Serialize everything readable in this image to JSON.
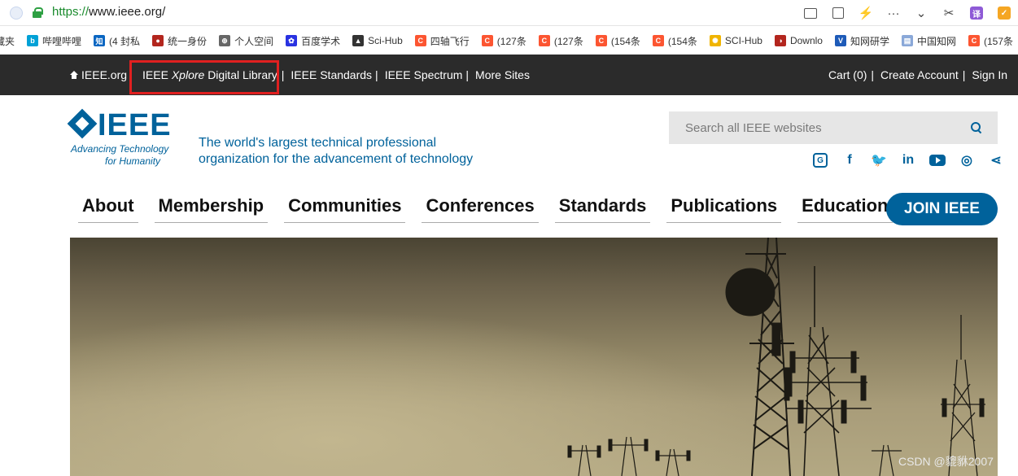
{
  "browser": {
    "url_scheme": "https://",
    "url_rest": "www.ieee.org/",
    "bookmarks": [
      {
        "label": "藏夹",
        "color": "#888888",
        "glyph": ""
      },
      {
        "label": "哔哩哔哩",
        "color": "#00a1d6",
        "glyph": "b"
      },
      {
        "label": "(4 封私",
        "color": "#0a66c2",
        "glyph": "知"
      },
      {
        "label": "统一身份",
        "color": "#b3261e",
        "glyph": "●"
      },
      {
        "label": "个人空间",
        "color": "#666666",
        "glyph": "⊕"
      },
      {
        "label": "百度学术",
        "color": "#2932e1",
        "glyph": "✿"
      },
      {
        "label": "Sci-Hub",
        "color": "#333333",
        "glyph": "▲"
      },
      {
        "label": "四轴飞行",
        "color": "#fc5531",
        "glyph": "C"
      },
      {
        "label": "(127条",
        "color": "#fc5531",
        "glyph": "C"
      },
      {
        "label": "(127条",
        "color": "#fc5531",
        "glyph": "C"
      },
      {
        "label": "(154条",
        "color": "#fc5531",
        "glyph": "C"
      },
      {
        "label": "(154条",
        "color": "#fc5531",
        "glyph": "C"
      },
      {
        "label": "SCI-Hub",
        "color": "#f0b400",
        "glyph": "✺"
      },
      {
        "label": "Downlo",
        "color": "#b3261e",
        "glyph": "◑"
      },
      {
        "label": "知网研学",
        "color": "#1e5bb8",
        "glyph": "V"
      },
      {
        "label": "中国知网",
        "color": "#8aa8d8",
        "glyph": "▤"
      },
      {
        "label": "(157条",
        "color": "#fc5531",
        "glyph": "C"
      }
    ]
  },
  "topbar": {
    "home": "IEEE.org",
    "xplore_prefix": "IEEE",
    "xplore_italic": "Xplore",
    "xplore_suffix": "Digital Library",
    "standards": "IEEE Standards",
    "spectrum": "IEEE Spectrum",
    "more": "More Sites",
    "cart": "Cart (0)",
    "create": "Create Account",
    "signin": "Sign In",
    "sep": "|"
  },
  "header": {
    "logo_word": "IEEE",
    "logo_tag1": "Advancing Technology",
    "logo_tag2": "for Humanity",
    "tagline1": "The world's largest technical professional",
    "tagline2": "organization for the advancement of technology",
    "search_placeholder": "Search all IEEE websites"
  },
  "social": [
    {
      "name": "ieee-collabratec-icon",
      "glyph": "G"
    },
    {
      "name": "facebook-icon",
      "glyph": "f"
    },
    {
      "name": "twitter-icon",
      "glyph": "🐦"
    },
    {
      "name": "linkedin-icon",
      "glyph": "in"
    },
    {
      "name": "youtube-icon",
      "glyph": ""
    },
    {
      "name": "instagram-icon",
      "glyph": "◎"
    },
    {
      "name": "share-icon",
      "glyph": "⋖"
    }
  ],
  "nav": [
    "About",
    "Membership",
    "Communities",
    "Conferences",
    "Standards",
    "Publications",
    "Education"
  ],
  "join": "JOIN IEEE",
  "watermark": "CSDN @貔貅2007",
  "colors": {
    "brand": "#00629b",
    "topbar": "#2b2b2b",
    "highlight": "#e02020"
  }
}
